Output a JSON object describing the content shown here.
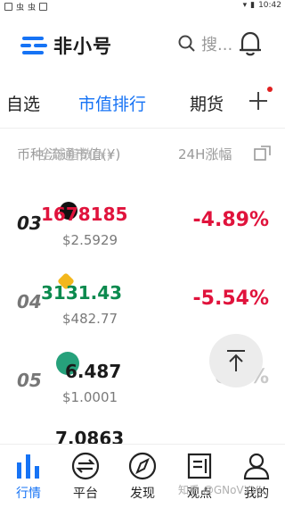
{
  "status_bar": {
    "left_icons": [
      "image-icon",
      "notification-icon",
      "notification-icon",
      "app-icon"
    ],
    "time": "10:42"
  },
  "header": {
    "app_name": "非小号",
    "search_placeholder": "搜...",
    "brand_color": "#1673f5"
  },
  "tabs": {
    "items": [
      {
        "label": "自选"
      },
      {
        "label": "市值排行"
      },
      {
        "label": "期货"
      }
    ],
    "active_index": 1
  },
  "columns": {
    "name_head": "币种/流通市值(¥)",
    "price_head": "全球指数(¥)",
    "change_head": "24H涨幅"
  },
  "rows": [
    {
      "rank": "03",
      "price": "1678185",
      "usd": "$2.5929",
      "change": "-4.89%"
    },
    {
      "rank": "04",
      "price": "3131.43",
      "usd": "$482.77",
      "change": "-5.54%"
    },
    {
      "rank": "05",
      "price": "6.487",
      "usd": "$1.0001",
      "change": "0.0%"
    },
    {
      "rank": "",
      "price": "7.0863",
      "usd": "",
      "change": ""
    }
  ],
  "bottom_nav": {
    "items": [
      {
        "label": "行情",
        "icon": "chart-bars-icon"
      },
      {
        "label": "平台",
        "icon": "exchange-icon"
      },
      {
        "label": "发现",
        "icon": "compass-icon"
      },
      {
        "label": "观点",
        "icon": "document-icon"
      },
      {
        "label": "我的",
        "icon": "user-icon"
      }
    ],
    "active_index": 0
  },
  "watermark": "知乎 @GNoVXVL"
}
